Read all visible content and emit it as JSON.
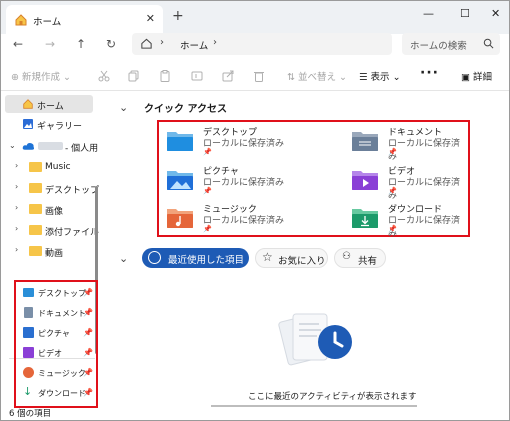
{
  "window": {
    "tab_title": "ホーム",
    "controls": {
      "minimize": "—",
      "maximize": "☐",
      "close": "✕"
    }
  },
  "address": {
    "path": "ホーム",
    "search_placeholder": "ホームの検索"
  },
  "toolbar": {
    "new": "新規作成",
    "sort": "並べ替え",
    "view": "表示",
    "more": "···",
    "details": "詳細"
  },
  "sidebar": {
    "home": "ホーム",
    "gallery": "ギャラリー",
    "onedrive": "- 個人用",
    "folders": [
      "Music",
      "デスクトップ",
      "画像",
      "添付ファイル",
      "動画"
    ],
    "quick": [
      "デスクトップ",
      "ドキュメント",
      "ピクチャ",
      "ビデオ",
      "ミュージック",
      "ダウンロード"
    ]
  },
  "status": "6 個の項目",
  "quick_access": {
    "header": "クイック アクセス",
    "items": [
      {
        "name": "デスクトップ",
        "sub": "ローカルに保存済み"
      },
      {
        "name": "ドキュメント",
        "sub": "ローカルに保存済み"
      },
      {
        "name": "ピクチャ",
        "sub": "ローカルに保存済み"
      },
      {
        "name": "ビデオ",
        "sub": "ローカルに保存済み"
      },
      {
        "name": "ミュージック",
        "sub": "ローカルに保存済み"
      },
      {
        "name": "ダウンロード",
        "sub": "ローカルに保存済み"
      }
    ]
  },
  "recent_tabs": [
    "最近使用した項目",
    "お気に入り",
    "共有"
  ],
  "empty_message": "ここに最近のアクティビティが表示されます",
  "colors": {
    "accent": "#1e5bb5",
    "highlight": "#e0101a"
  }
}
